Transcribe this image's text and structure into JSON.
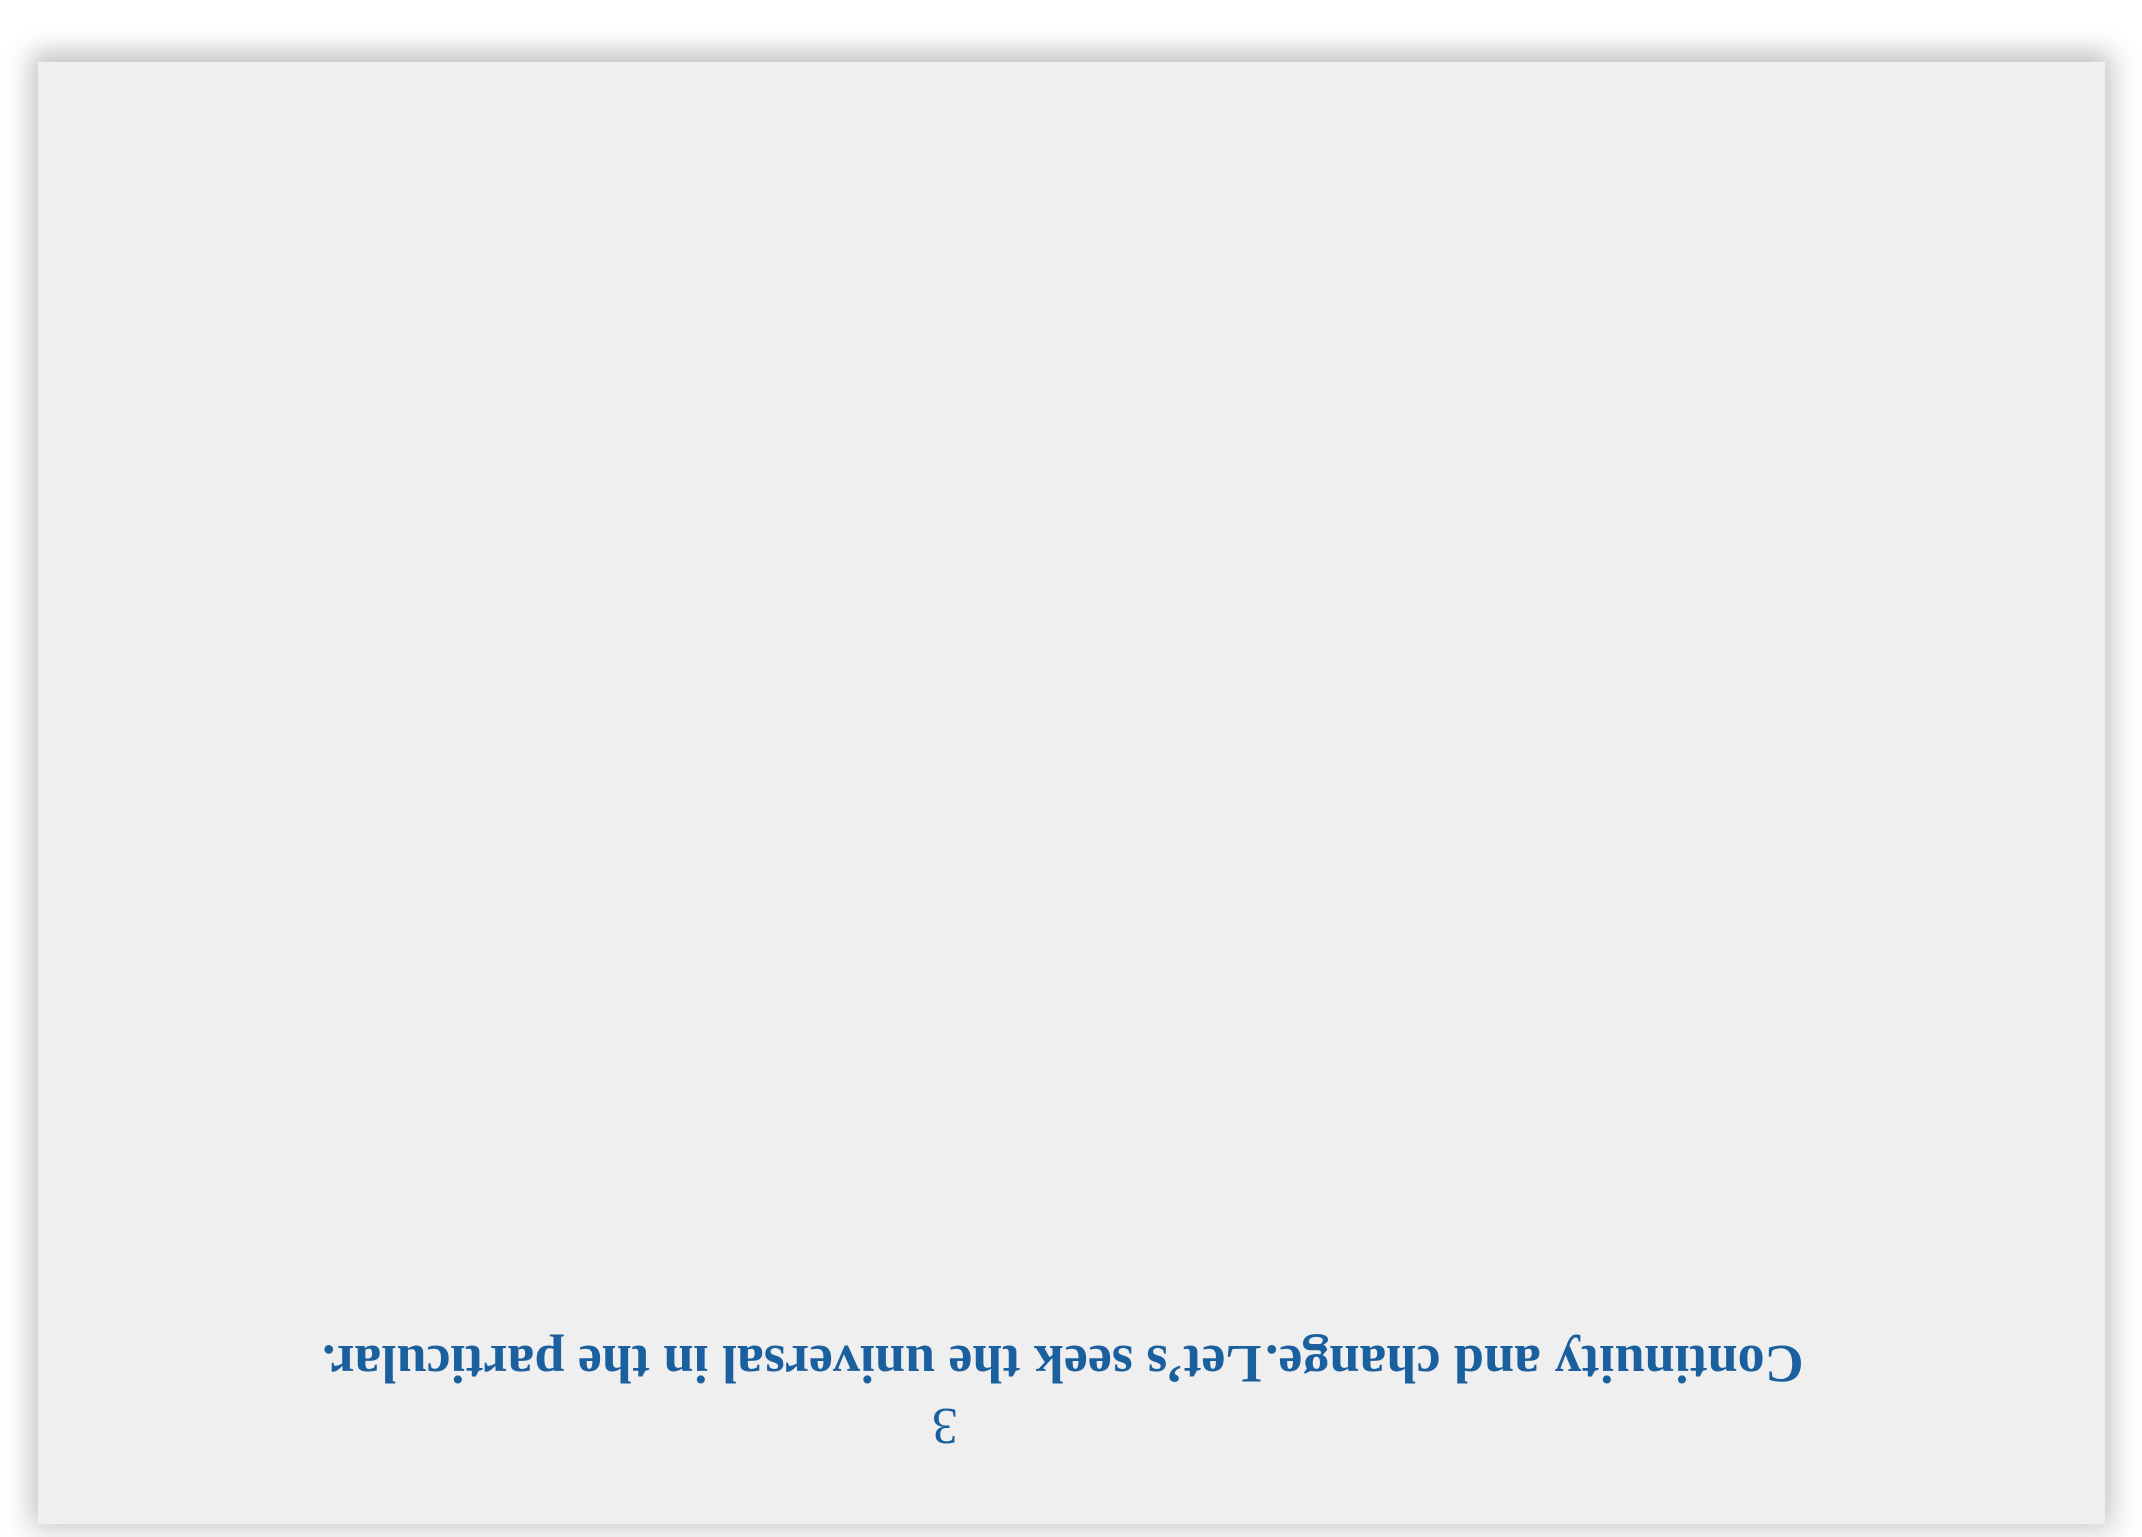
{
  "card": {
    "quote_1": "Let’s seek the universal in the particular.",
    "quote_2": "Continuity and change.",
    "page_number": "3",
    "text_color": "#1a5f9e",
    "paper_color": "#efefef",
    "orientation": "upside-down"
  }
}
